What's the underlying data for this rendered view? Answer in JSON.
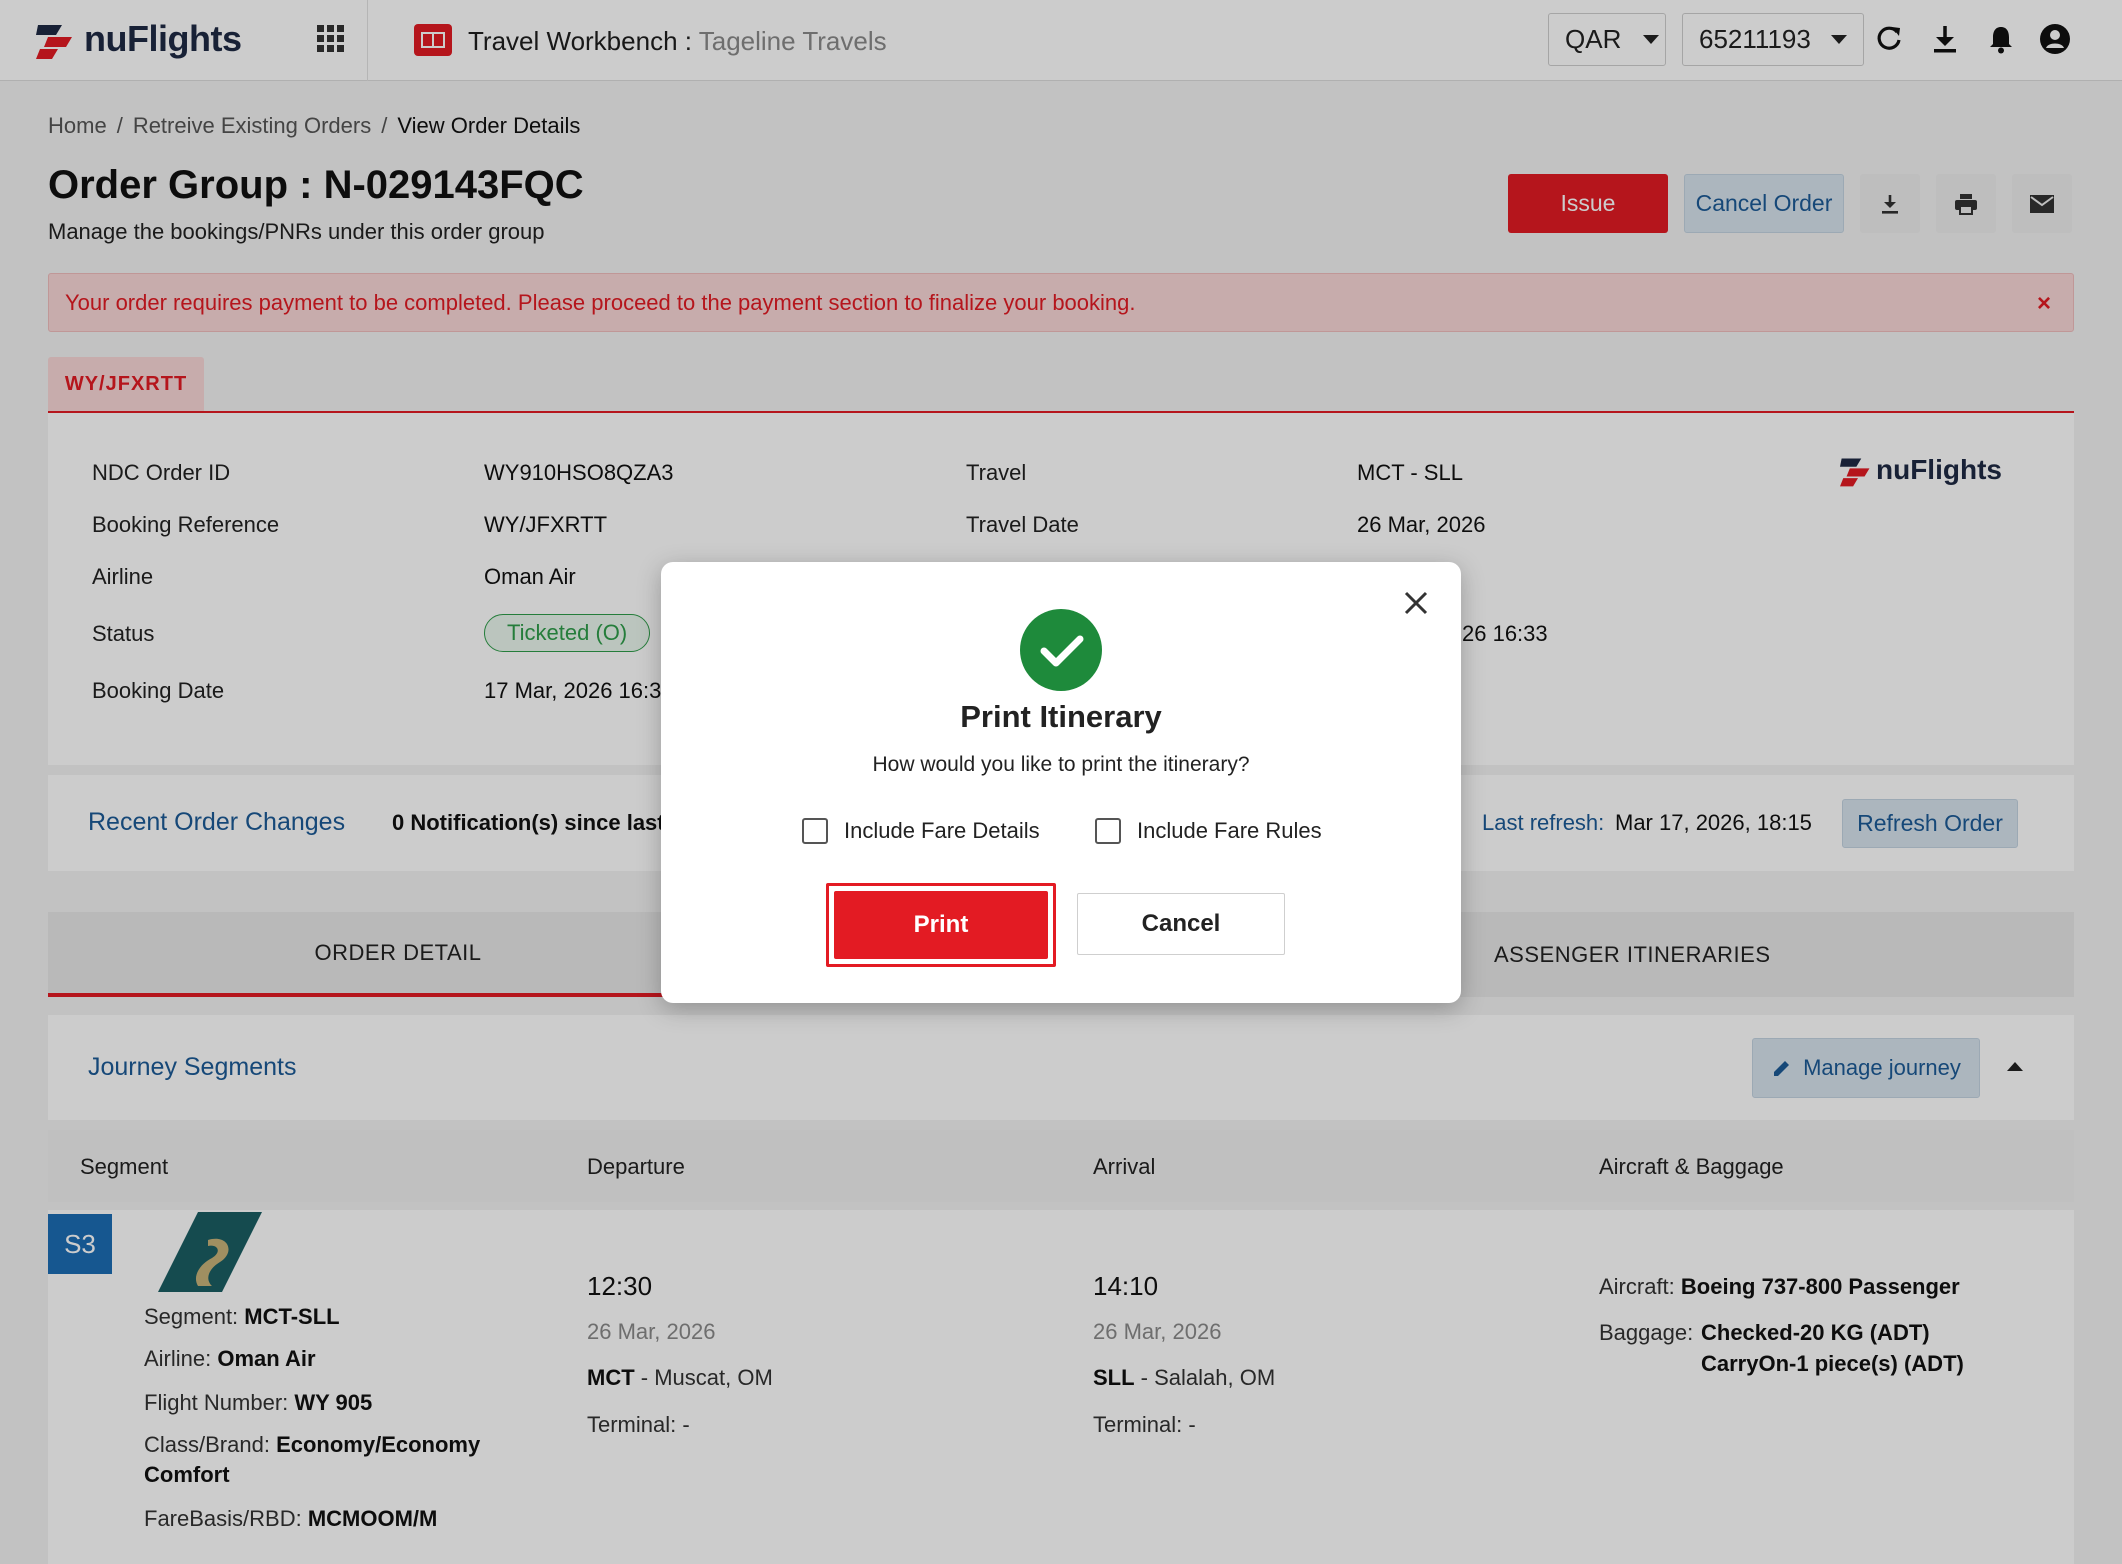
{
  "header": {
    "logo_text": "nuFlights",
    "workbench_title": "Travel Workbench :",
    "workbench_agency": "Tageline Travels",
    "currency": "QAR",
    "account": "65211193"
  },
  "breadcrumb": {
    "home": "Home",
    "sep": "/",
    "retrieve": "Retreive Existing Orders",
    "current": "View Order Details"
  },
  "order_group": {
    "title": "Order Group : N-029143FQC",
    "subtitle": "Manage the bookings/PNRs under this order group",
    "issue_label": "Issue",
    "cancel_label": "Cancel Order"
  },
  "alert": {
    "text": "Your order requires payment to be completed. Please proceed to the payment section to finalize your booking.",
    "close": "×"
  },
  "pnr_tab": "WY/JFXRTT",
  "details": {
    "ndc_label": "NDC Order ID",
    "ndc_value": "WY910HSO8QZA3",
    "booking_ref_label": "Booking Reference",
    "booking_ref_value": "WY/JFXRTT",
    "airline_label": "Airline",
    "airline_value": "Oman Air",
    "status_label": "Status",
    "status_value": "Ticketed (O)",
    "booking_date_label": "Booking Date",
    "booking_date_value": "17 Mar, 2026 16:3",
    "travel_label": "Travel",
    "travel_value": "MCT - SLL",
    "travel_date_label": "Travel Date",
    "travel_date_value": "26 Mar, 2026",
    "partial_time": "26 16:33",
    "logo_text": "nuFlights"
  },
  "recent": {
    "title": "Recent Order Changes",
    "notifications": "0 Notification(s) since last",
    "last_refresh_label": "Last refresh:",
    "last_refresh_value": "Mar 17, 2026, 18:15",
    "refresh_label": "Refresh Order"
  },
  "tabs": {
    "order_detail": "ORDER DETAIL",
    "passenger_itineraries": "ASSENGER ITINERARIES"
  },
  "journey": {
    "title": "Journey Segments",
    "manage_label": "Manage journey",
    "columns": [
      "Segment",
      "Departure",
      "Arrival",
      "Aircraft & Baggage"
    ],
    "segment": {
      "badge": "S3",
      "segment_label": "Segment:",
      "segment_value": "MCT-SLL",
      "airline_label": "Airline:",
      "airline_value": "Oman Air",
      "flight_label": "Flight Number:",
      "flight_value": "WY 905",
      "class_label": "Class/Brand:",
      "class_value_1": "Economy/Economy",
      "class_value_2": "Comfort",
      "fare_label": "FareBasis/RBD:",
      "fare_value": "MCMOOM/M",
      "dep_time": "12:30",
      "dep_date": "26 Mar, 2026",
      "dep_code": "MCT",
      "dep_city": " - Muscat, OM",
      "dep_terminal": "Terminal: -",
      "arr_time": "14:10",
      "arr_date": "26 Mar, 2026",
      "arr_code": "SLL",
      "arr_city": " - Salalah, OM",
      "arr_terminal": "Terminal: -",
      "aircraft_label": "Aircraft:",
      "aircraft_value": "Boeing 737-800 Passenger",
      "baggage_label": "Baggage:",
      "baggage_value_1": "Checked-20 KG (ADT)",
      "baggage_value_2": "CarryOn-1 piece(s) (ADT)"
    }
  },
  "modal": {
    "title": "Print Itinerary",
    "question": "How would you like to print the itinerary?",
    "option_fare_details": "Include Fare Details",
    "option_fare_rules": "Include Fare Rules",
    "print_label": "Print",
    "cancel_label": "Cancel"
  },
  "colors": {
    "brand_red": "#e31b23",
    "link_blue": "#1c5a96",
    "success_green": "#1e8a3b"
  },
  "icons": [
    "apps-grid-icon",
    "refresh-icon",
    "download-icon",
    "bell-icon",
    "account-icon",
    "print-icon",
    "mail-icon",
    "close-icon",
    "check-icon",
    "pencil-icon"
  ]
}
